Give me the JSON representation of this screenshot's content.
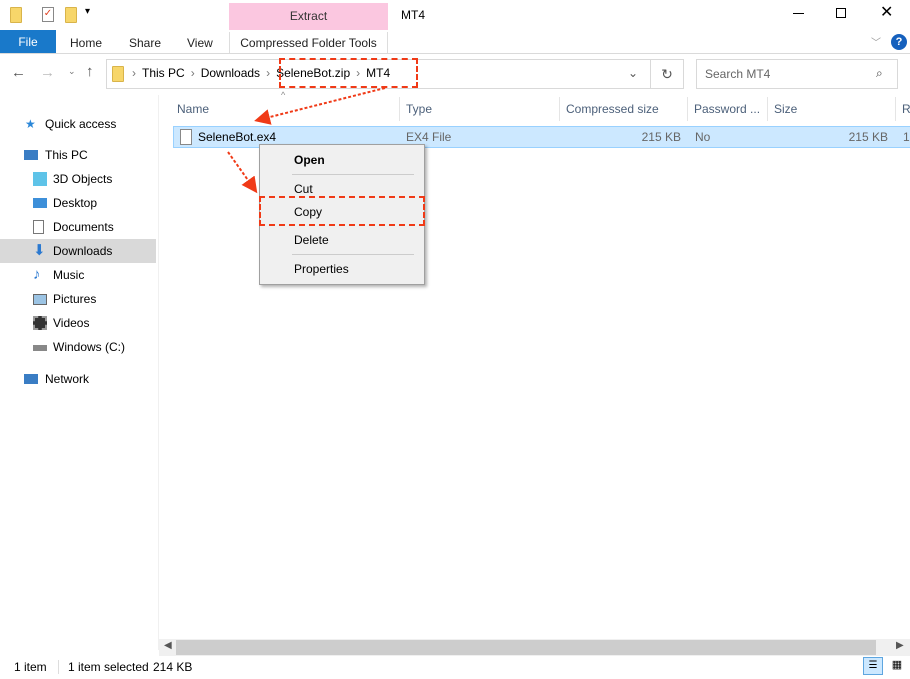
{
  "window": {
    "title": "MT4",
    "contextual_tab": "Extract",
    "contextual_group": "Compressed Folder Tools"
  },
  "ribbon": {
    "tabs": [
      "File",
      "Home",
      "Share",
      "View"
    ]
  },
  "breadcrumb": [
    "This PC",
    "Downloads",
    "SeleneBot.zip",
    "MT4"
  ],
  "search": {
    "placeholder": "Search MT4"
  },
  "sidebar": {
    "items": [
      {
        "label": "Quick access",
        "icon": "star-icon"
      },
      {
        "label": "This PC",
        "icon": "computer-icon"
      },
      {
        "label": "3D Objects",
        "icon": "cube-icon"
      },
      {
        "label": "Desktop",
        "icon": "desktop-icon"
      },
      {
        "label": "Documents",
        "icon": "document-icon"
      },
      {
        "label": "Downloads",
        "icon": "download-icon",
        "selected": true
      },
      {
        "label": "Music",
        "icon": "music-icon"
      },
      {
        "label": "Pictures",
        "icon": "pictures-icon"
      },
      {
        "label": "Videos",
        "icon": "video-icon"
      },
      {
        "label": "Windows (C:)",
        "icon": "drive-icon"
      },
      {
        "label": "Network",
        "icon": "network-icon"
      }
    ]
  },
  "columns": [
    "Name",
    "Type",
    "Compressed size",
    "Password ...",
    "Size",
    "R"
  ],
  "files": [
    {
      "name": "SeleneBot.ex4",
      "type": "EX4 File",
      "compressed": "215 KB",
      "password": "No",
      "size": "215 KB",
      "ratio": "1"
    }
  ],
  "context_menu": [
    "Open",
    "Cut",
    "Copy",
    "Delete",
    "Properties"
  ],
  "status": {
    "count": "1 item",
    "selected": "1 item selected",
    "size": "214 KB"
  },
  "colors": {
    "accent": "#1979ca",
    "selection": "#cce8ff",
    "annotation": "#f03a17",
    "extract_tab": "#fbc7e0"
  }
}
